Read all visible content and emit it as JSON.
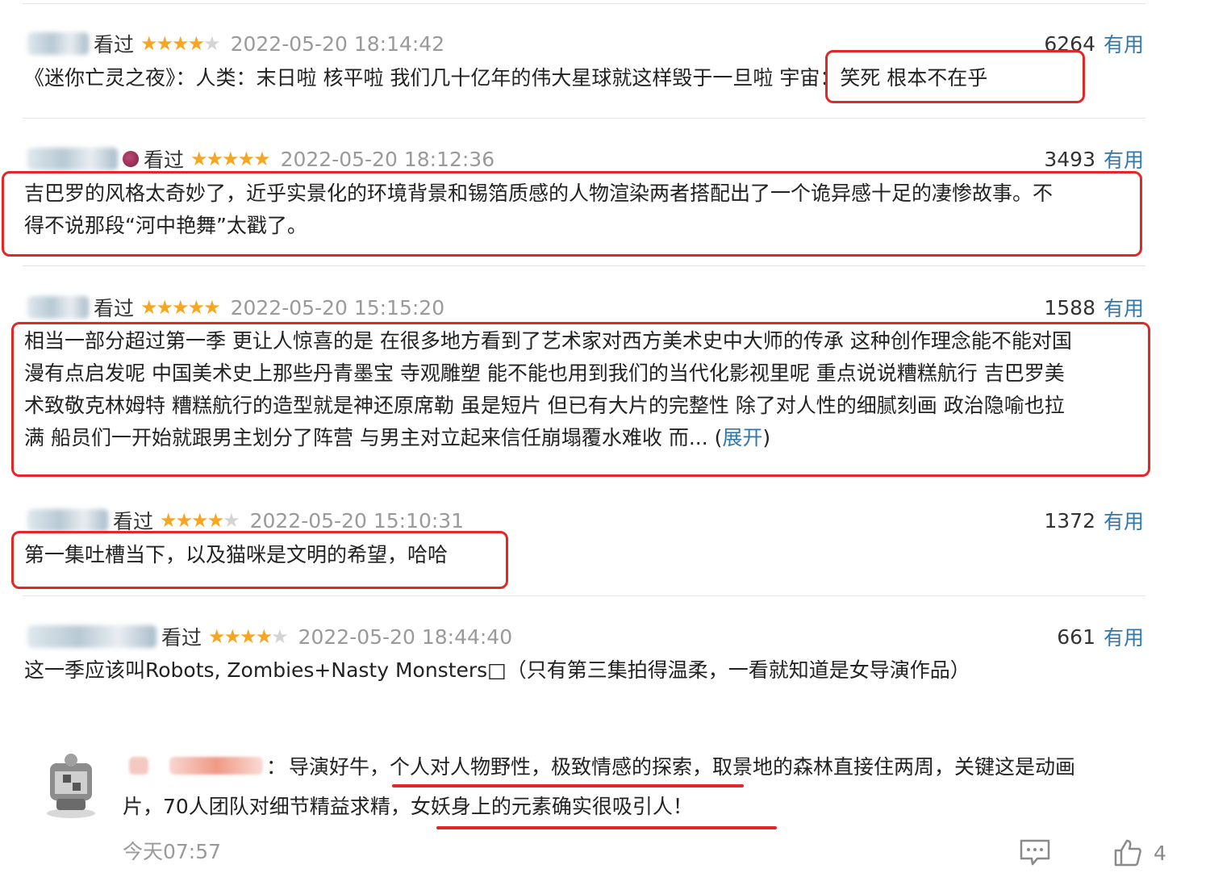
{
  "reviews": [
    {
      "status": "看过",
      "rating": 4,
      "time": "2022-05-20 18:14:42",
      "votes": "6264",
      "useful": "有用",
      "text": "《迷你亡灵之夜》：人类：末日啦 核平啦 我们几十亿年的伟大星球就这样毁于一旦啦 宇宙：笑死 根本不在乎"
    },
    {
      "status": "看过",
      "rating": 5,
      "time": "2022-05-20 18:12:36",
      "votes": "3493",
      "useful": "有用",
      "lines": [
        "吉巴罗的风格太奇妙了，近乎实景化的环境背景和锡箔质感的人物渲染两者搭配出了一个诡异感十足的凄惨故事。不",
        "得不说那段“河中艳舞”太戳了。"
      ]
    },
    {
      "status": "看过",
      "rating": 5,
      "time": "2022-05-20 15:15:20",
      "votes": "1588",
      "useful": "有用",
      "lines": [
        "相当一部分超过第一季 更让人惊喜的是 在很多地方看到了艺术家对西方美术史中大师的传承 这种创作理念能不能对国",
        "漫有点启发呢 中国美术史上那些丹青墨宝 寺观雕塑 能不能也用到我们的当代化影视里呢 重点说说糟糕航行 吉巴罗美",
        "术致敬克林姆特 糟糕航行的造型就是神还原席勒 虽是短片 但已有大片的完整性 除了对人性的细腻刻画 政治隐喻也拉",
        "满 船员们一开始就跟男主划分了阵营 与男主对立起来信任崩塌覆水难收 而..."
      ],
      "expand_open": "(",
      "expand": "展开",
      "expand_close": ")"
    },
    {
      "status": "看过",
      "rating": 4,
      "time": "2022-05-20 15:10:31",
      "votes": "1372",
      "useful": "有用",
      "text": "第一集吐槽当下，以及猫咪是文明的希望，哈哈"
    },
    {
      "status": "看过",
      "rating": 4,
      "time": "2022-05-20 18:44:40",
      "votes": "661",
      "useful": "有用",
      "text": "这一季应该叫Robots, Zombies+Nasty Monsters□（只有第三集拍得温柔，一看就知道是女导演作品）"
    }
  ],
  "comment": {
    "separator": "：",
    "line1": "导演好牛，个人对人物野性，极致情感的探索，取景地的森林直接住两周，关键这是动画",
    "line2": "片，70人团队对细节精益求精，女妖身上的元素确实很吸引人！",
    "time": "今天07:57",
    "likes": "4",
    "reply_icon": "comment-icon",
    "like_icon": "thumbs-up-icon"
  },
  "colors": {
    "link": "#3377aa",
    "star": "#f5a623",
    "highlight": "#e32626",
    "timestamp": "#9a9a9a"
  }
}
